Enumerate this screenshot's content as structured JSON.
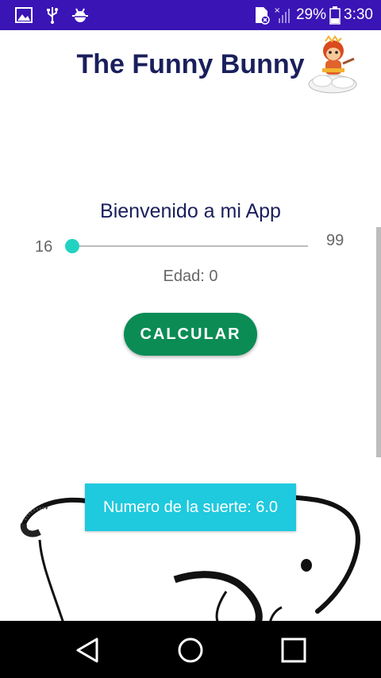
{
  "status_bar": {
    "battery_percent": "29%",
    "time": "3:30",
    "icons": [
      "image-icon",
      "usb-icon",
      "android-debug-icon",
      "no-sim-icon",
      "signal-icon",
      "battery-icon"
    ],
    "background_color": "#3a14b5"
  },
  "header": {
    "title": "The Funny Bunny",
    "title_color": "#1a1f5c",
    "mascot_icon": "monkey-on-cloud-icon"
  },
  "main": {
    "welcome": "Bienvenido a mi App",
    "slider": {
      "min_label": "16",
      "max_label": "99",
      "value_fraction": 0.0,
      "thumb_color": "#22d3c2"
    },
    "age_text": "Edad: 0",
    "calculate_button": {
      "label": "CALCULAR",
      "color": "#0b8c55"
    },
    "bunny_image": "bunny-drawing-icon"
  },
  "toast": {
    "text": "Numero de la suerte: 6.0",
    "color": "#1fc9de"
  },
  "nav_bar": {
    "buttons": [
      "back-icon",
      "home-icon",
      "recent-apps-icon"
    ]
  }
}
